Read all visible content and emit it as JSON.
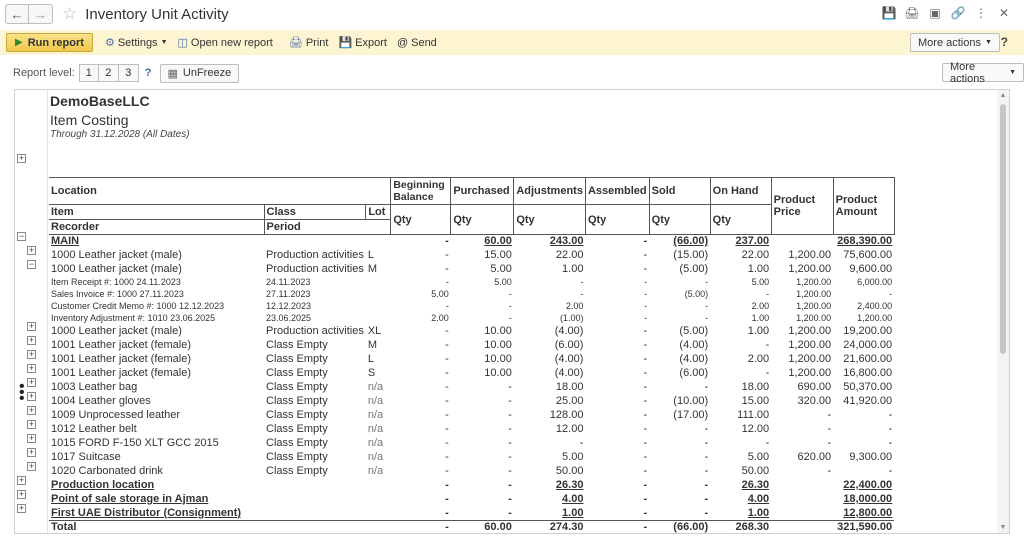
{
  "window": {
    "title": "Inventory Unit Activity",
    "icons": [
      "save-icon",
      "print-icon",
      "preview-icon",
      "link-icon",
      "menu-icon",
      "close-icon"
    ]
  },
  "toolbar": {
    "run_report": "Run report",
    "settings": "Settings",
    "open_new_report": "Open new report",
    "print": "Print",
    "export": "Export",
    "send": "Send",
    "more_actions": "More actions",
    "help": "?"
  },
  "levels": {
    "label": "Report level:",
    "items": [
      "1",
      "2",
      "3"
    ],
    "help": "?",
    "unfreeze": "UnFreeze",
    "more_actions": "More actions"
  },
  "report": {
    "company": "DemoBaseLLC",
    "title": "Item Costing",
    "period": "Through 31.12.2028 (All Dates)"
  },
  "headers": {
    "location": "Location",
    "item": "Item",
    "recorder": "Recorder",
    "class": "Class",
    "period": "Period",
    "lot": "Lot",
    "beginning_balance": "Beginning Balance",
    "purchased": "Purchased",
    "adjustments": "Adjustments",
    "assembled": "Assembled",
    "sold": "Sold",
    "on_hand": "On Hand",
    "product_price": "Product Price",
    "product_amount": "Product Amount",
    "qty": "Qty"
  },
  "rows": [
    {
      "level": 0,
      "group": true,
      "name": "MAIN",
      "class": "",
      "lot": "",
      "beg": "-",
      "pur": "60.00",
      "adj": "243.00",
      "asm": "-",
      "sold": "(66.00)",
      "onhand": "237.00",
      "price": "",
      "amount": "268,390.00"
    },
    {
      "level": 1,
      "name": "1000 Leather jacket (male)",
      "class": "Production activities",
      "lot": "L",
      "beg": "-",
      "pur": "15.00",
      "adj": "22.00",
      "asm": "-",
      "sold": "(15.00)",
      "onhand": "22.00",
      "price": "1,200.00",
      "amount": "75,600.00"
    },
    {
      "level": 1,
      "name": "1000 Leather jacket (male)",
      "class": "Production activities",
      "lot": "M",
      "beg": "-",
      "pur": "5.00",
      "adj": "1.00",
      "asm": "-",
      "sold": "(5.00)",
      "onhand": "1.00",
      "price": "1,200.00",
      "amount": "9,600.00"
    },
    {
      "level": 2,
      "name": "Item Receipt #: 1000 24.11.2023",
      "class": "24.11.2023",
      "lot": "",
      "beg": "-",
      "pur": "5.00",
      "adj": "-",
      "asm": "-",
      "sold": "-",
      "onhand": "5.00",
      "price": "1,200.00",
      "amount": "6,000.00"
    },
    {
      "level": 2,
      "name": "Sales Invoice #: 1000 27.11.2023",
      "class": "27.11.2023",
      "lot": "",
      "beg": "5.00",
      "pur": "-",
      "adj": "-",
      "asm": "-",
      "sold": "(5.00)",
      "onhand": "-",
      "price": "1,200.00",
      "amount": "-"
    },
    {
      "level": 2,
      "name": "Customer Credit Memo #: 1000 12.12.2023",
      "class": "12.12.2023",
      "lot": "",
      "beg": "-",
      "pur": "-",
      "adj": "2.00",
      "asm": "-",
      "sold": "-",
      "onhand": "2.00",
      "price": "1,200.00",
      "amount": "2,400.00"
    },
    {
      "level": 2,
      "name": "Inventory Adjustment #: 1010 23.06.2025",
      "class": "23.06.2025",
      "lot": "",
      "beg": "2.00",
      "pur": "-",
      "adj": "(1.00)",
      "asm": "-",
      "sold": "-",
      "onhand": "1.00",
      "price": "1,200.00",
      "amount": "1,200.00"
    },
    {
      "level": 1,
      "name": "1000 Leather jacket (male)",
      "class": "Production activities",
      "lot": "XL",
      "beg": "-",
      "pur": "10.00",
      "adj": "(4.00)",
      "asm": "-",
      "sold": "(5.00)",
      "onhand": "1.00",
      "price": "1,200.00",
      "amount": "19,200.00"
    },
    {
      "level": 1,
      "name": "1001 Leather jacket (female)",
      "class": "Class Empty",
      "lot": "M",
      "beg": "-",
      "pur": "10.00",
      "adj": "(6.00)",
      "asm": "-",
      "sold": "(4.00)",
      "onhand": "-",
      "price": "1,200.00",
      "amount": "24,000.00"
    },
    {
      "level": 1,
      "name": "1001 Leather jacket (female)",
      "class": "Class Empty",
      "lot": "L",
      "beg": "-",
      "pur": "10.00",
      "adj": "(4.00)",
      "asm": "-",
      "sold": "(4.00)",
      "onhand": "2.00",
      "price": "1,200.00",
      "amount": "21,600.00"
    },
    {
      "level": 1,
      "name": "1001 Leather jacket (female)",
      "class": "Class Empty",
      "lot": "S",
      "beg": "-",
      "pur": "10.00",
      "adj": "(4.00)",
      "asm": "-",
      "sold": "(6.00)",
      "onhand": "-",
      "price": "1,200.00",
      "amount": "16,800.00"
    },
    {
      "level": 1,
      "name": "1003 Leather bag",
      "class": "Class Empty",
      "lot": "n/a",
      "beg": "-",
      "pur": "-",
      "adj": "18.00",
      "asm": "-",
      "sold": "-",
      "onhand": "18.00",
      "price": "690.00",
      "amount": "50,370.00"
    },
    {
      "level": 1,
      "name": "1004 Leather gloves",
      "class": "Class Empty",
      "lot": "n/a",
      "beg": "-",
      "pur": "-",
      "adj": "25.00",
      "asm": "-",
      "sold": "(10.00)",
      "onhand": "15.00",
      "price": "320.00",
      "amount": "41,920.00"
    },
    {
      "level": 1,
      "name": "1009 Unprocessed leather",
      "class": "Class Empty",
      "lot": "n/a",
      "beg": "-",
      "pur": "-",
      "adj": "128.00",
      "asm": "-",
      "sold": "(17.00)",
      "onhand": "111.00",
      "price": "-",
      "amount": "-"
    },
    {
      "level": 1,
      "name": "1012 Leather belt",
      "class": "Class Empty",
      "lot": "n/a",
      "beg": "-",
      "pur": "-",
      "adj": "12.00",
      "asm": "-",
      "sold": "-",
      "onhand": "12.00",
      "price": "-",
      "amount": "-"
    },
    {
      "level": 1,
      "name": "1015 FORD F-150 XLT GCC 2015",
      "class": "Class Empty",
      "lot": "n/a",
      "beg": "-",
      "pur": "-",
      "adj": "-",
      "asm": "-",
      "sold": "-",
      "onhand": "-",
      "price": "-",
      "amount": "-"
    },
    {
      "level": 1,
      "name": "1017 Suitcase",
      "class": "Class Empty",
      "lot": "n/a",
      "beg": "-",
      "pur": "-",
      "adj": "5.00",
      "asm": "-",
      "sold": "-",
      "onhand": "5.00",
      "price": "620.00",
      "amount": "9,300.00"
    },
    {
      "level": 1,
      "name": "1020 Carbonated drink",
      "class": "Class Empty",
      "lot": "n/a",
      "beg": "-",
      "pur": "-",
      "adj": "50.00",
      "asm": "-",
      "sold": "-",
      "onhand": "50.00",
      "price": "-",
      "amount": "-"
    },
    {
      "level": 0,
      "group": true,
      "name": "Production location",
      "class": "",
      "lot": "",
      "beg": "-",
      "pur": "-",
      "adj": "26.30",
      "asm": "-",
      "sold": "-",
      "onhand": "26.30",
      "price": "",
      "amount": "22,400.00"
    },
    {
      "level": 0,
      "group": true,
      "name": "Point of sale storage in Ajman",
      "class": "",
      "lot": "",
      "beg": "-",
      "pur": "-",
      "adj": "4.00",
      "asm": "-",
      "sold": "-",
      "onhand": "4.00",
      "price": "",
      "amount": "18,000.00"
    },
    {
      "level": 0,
      "group": true,
      "name": "First UAE Distributor (Consignment)",
      "class": "",
      "lot": "",
      "beg": "-",
      "pur": "-",
      "adj": "1.00",
      "asm": "-",
      "sold": "-",
      "onhand": "1.00",
      "price": "",
      "amount": "12,800.00"
    }
  ],
  "total": {
    "name": "Total",
    "beg": "-",
    "pur": "60.00",
    "adj": "274.30",
    "asm": "-",
    "sold": "(66.00)",
    "onhand": "268.30",
    "price": "",
    "amount": "321,590.00"
  }
}
